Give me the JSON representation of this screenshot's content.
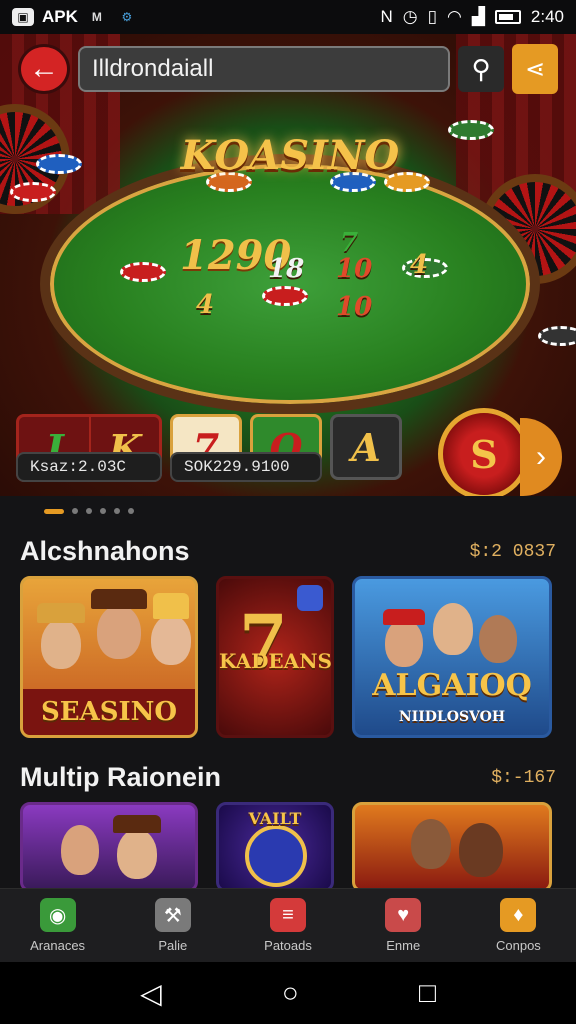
{
  "status_bar": {
    "app_label": "APK",
    "time": "2:40",
    "icons": [
      "app-badge-icon",
      "gmail-icon",
      "settings-gear-icon",
      "nfc-icon",
      "alarm-icon",
      "vibrate-icon",
      "wifi-icon",
      "signal-icon",
      "battery-icon"
    ]
  },
  "search": {
    "value": "Illdrondaiall",
    "back_icon": "back-arrow-icon",
    "search_icon": "search-icon",
    "share_icon": "share-icon"
  },
  "hero": {
    "title": "KOASINO",
    "big_number": "1290",
    "table_numbers": [
      "7",
      "4",
      "18",
      "10",
      "4",
      "10"
    ],
    "slots": [
      "J",
      "K",
      "7",
      "O",
      "A"
    ],
    "balance_left": "Ksaz:2.03C",
    "balance_right": "SOK229.9100",
    "spin_glyph": "S",
    "next_glyph": "›",
    "carousel_dots": 6,
    "active_dot": 0
  },
  "sections": [
    {
      "title": "Alcshnahons",
      "count": "$:2 0837",
      "cards": [
        {
          "label": "SEASINO"
        },
        {
          "label": "KADEANS"
        },
        {
          "label": "ALGAIOQ",
          "sublabel": "NIIDLOSVOH"
        }
      ]
    },
    {
      "title": "Multip Raionein",
      "count": "$:-167",
      "cards": [
        {
          "label": ""
        },
        {
          "label": "VAILT"
        },
        {
          "label": ""
        }
      ]
    }
  ],
  "bottom_nav": [
    {
      "label": "Aranaces",
      "icon": "camera-icon",
      "color": "#3a9a3a"
    },
    {
      "label": "Palie",
      "icon": "hammer-icon",
      "color": "#7a7a7a"
    },
    {
      "label": "Patoads",
      "icon": "list-icon",
      "color": "#d43a3a"
    },
    {
      "label": "Enme",
      "icon": "heart-target-icon",
      "color": "#c94a4a"
    },
    {
      "label": "Conpos",
      "icon": "coupon-icon",
      "color": "#e59a23"
    }
  ],
  "system_nav": {
    "back": "◁",
    "home": "○",
    "recents": "□"
  }
}
